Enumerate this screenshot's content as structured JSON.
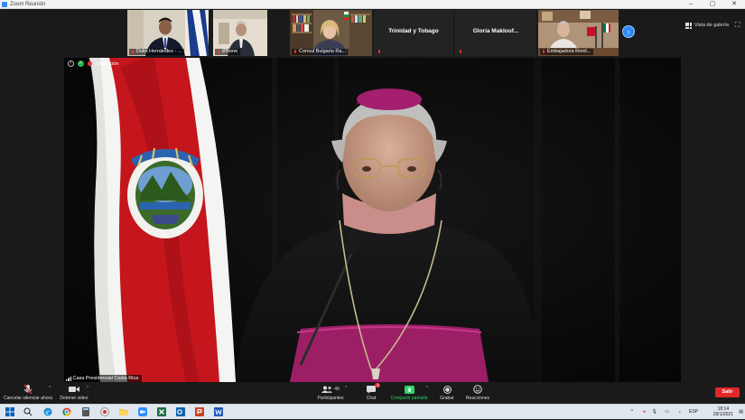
{
  "window": {
    "title": "Zoom Reunión"
  },
  "gallery": {
    "tiles": [
      {
        "name": "Dulio Hernández - ...",
        "type": "video"
      },
      {
        "name": "iPhone",
        "type": "video"
      },
      {
        "name": "Consul Bulgaria Ra...",
        "type": "video"
      },
      {
        "name": "Trinidad y Tobago",
        "type": "text"
      },
      {
        "name": "Gloria Maklouf...",
        "type": "text"
      },
      {
        "name": "Embajadora Ronil...",
        "type": "video"
      }
    ],
    "view_label": "Vista de galería"
  },
  "main": {
    "recording_label": "Grabación",
    "speaker_name": "Casa Presidencial Costa Rica"
  },
  "controls": {
    "audio_label": "Cancelar silenciar ahora",
    "video_label": "Detener video",
    "participants_label": "Participantes",
    "participants_count": "49",
    "chat_label": "Chat",
    "chat_badge": "1",
    "share_label": "Compartir pantalla",
    "record_label": "Grabar",
    "reactions_label": "Reacciones",
    "leave_label": "Salir"
  },
  "taskbar": {
    "language": "ESP",
    "time": "18:14",
    "date": "29/1/2021"
  },
  "colors": {
    "zoom_blue": "#2d8cff",
    "leave_red": "#e02828",
    "share_green": "#2fd365",
    "bishop_magenta": "#b8267a"
  }
}
